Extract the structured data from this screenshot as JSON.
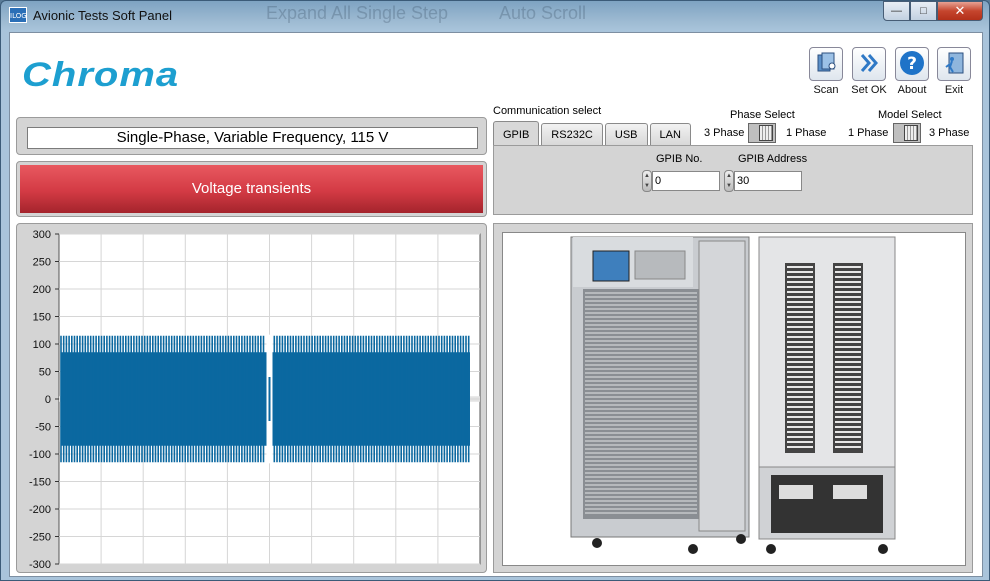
{
  "window": {
    "title": "Avionic Tests Soft Panel",
    "icon_text": "ILOG",
    "ghost_menu": [
      "Expand All",
      "Single Step",
      "Auto Scroll"
    ]
  },
  "logo": "Chroma",
  "toolbar": {
    "scan_label": "Scan",
    "setok_label": "Set OK",
    "about_label": "About",
    "exit_label": "Exit"
  },
  "mode": {
    "text": "Single-Phase, Variable Frequency, 115 V"
  },
  "test": {
    "label": "Voltage transients"
  },
  "comm": {
    "label": "Communication select",
    "tabs": [
      "GPIB",
      "RS232C",
      "USB",
      "LAN"
    ],
    "active_tab": "GPIB",
    "gpib_no_label": "GPIB No.",
    "gpib_no_value": "0",
    "gpib_addr_label": "GPIB Address",
    "gpib_addr_value": "30"
  },
  "phase_select": {
    "title": "Phase Select",
    "left": "3 Phase",
    "right": "1 Phase"
  },
  "model_select": {
    "title": "Model Select",
    "left": "1 Phase",
    "right": "3 Phase"
  },
  "colors": {
    "accent": "#1d9fd0",
    "test_bar": "#d33a44",
    "waveform": "#0b68a0"
  },
  "chart_data": {
    "type": "line",
    "ylim": [
      -300,
      300
    ],
    "yticks": [
      300,
      250,
      200,
      150,
      100,
      50,
      0,
      -50,
      -100,
      -150,
      -200,
      -250,
      -300
    ],
    "grid": true,
    "series": [
      {
        "description_values": {
          "steady_amplitude": 115,
          "peak_dip_amplitude": 85,
          "transient_position_fraction": 0.5
        }
      }
    ]
  }
}
